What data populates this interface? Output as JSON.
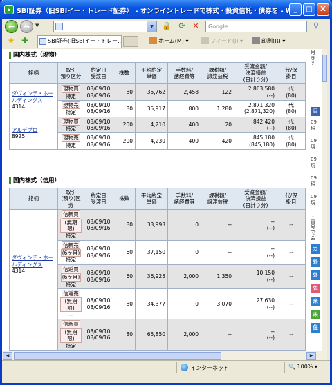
{
  "window": {
    "title": "SBI証券（旧SBIイー・トレード証券） - オンライントレードで株式・投資信託・債券を - Win...",
    "minimize": "_",
    "maximize": "□",
    "close": "X"
  },
  "addressbar": {
    "back": "←",
    "forward": "→",
    "url": "",
    "search_placeholder": "Google"
  },
  "tabs": {
    "active_tab": "SBI証券(旧SBIイー・トレー...",
    "home": "ホーム(M)",
    "feeds": "フィード(J)",
    "print": "印刷(R)"
  },
  "sections": [
    {
      "title": "国内株式（現物）",
      "headers": [
        "銘柄",
        "取引\n預り区分",
        "約定日\n受渡日",
        "株数",
        "平均約定\n単価",
        "手数料/\n諸経費等",
        "課税額/\n譲渡益税",
        "受渡金額/\n決済損益\n(日計り分)",
        "代/保\n掛目"
      ],
      "rows": [
        {
          "name": "ダヴィンチ・ホールディングス",
          "code": "4314",
          "type": "現物買",
          "sub": "特定",
          "date1": "08/09/10",
          "date2": "08/09/16",
          "qty": "80",
          "price": "35,762",
          "fee": "2,458",
          "tax": "122",
          "amt1": "2,863,580",
          "amt2": "(--)",
          "m1": "代",
          "m2": "(80)"
        },
        {
          "name": "",
          "code": "",
          "type": "現物売",
          "sub": "特定",
          "date1": "08/09/10",
          "date2": "08/09/16",
          "qty": "80",
          "price": "35,917",
          "fee": "800",
          "tax": "1,280",
          "amt1": "2,871,320",
          "amt2": "(2,871,320)",
          "m1": "代",
          "m2": "(80)"
        },
        {
          "name": "アルデプロ",
          "code": "8925",
          "type": "現物買",
          "sub": "特定",
          "date1": "08/09/10",
          "date2": "08/09/16",
          "qty": "200",
          "price": "4,210",
          "fee": "400",
          "tax": "20",
          "amt1": "842,420",
          "amt2": "(--)",
          "m1": "代",
          "m2": "(80)"
        },
        {
          "name": "",
          "code": "",
          "type": "現物売",
          "sub": "特定",
          "date1": "08/09/10",
          "date2": "08/09/16",
          "qty": "200",
          "price": "4,230",
          "fee": "400",
          "tax": "420",
          "amt1": "845,180",
          "amt2": "(845,180)",
          "m1": "代",
          "m2": "(80)"
        }
      ]
    },
    {
      "title": "国内株式（信用）",
      "headers": [
        "銘柄",
        "取引\n(預り)区\n分",
        "約定日\n受渡日",
        "株数",
        "平均約定\n単価",
        "手数料/\n諸経費等",
        "課税額/\n譲渡益税",
        "受渡金額/\n決済損益\n(日計り分)",
        "代/保\n掛目"
      ],
      "rows": [
        {
          "name": "ダヴィンチ・ホールディングス",
          "code": "4314",
          "type": "信新買",
          "type2": "(無期限)",
          "sub": "特定",
          "date1": "08/09/10",
          "date2": "08/09/16",
          "qty": "80",
          "price": "33,993",
          "fee": "0",
          "tax": "--",
          "amt1": "--",
          "amt2": "(--)",
          "m1": "--",
          "m2": ""
        },
        {
          "name": "",
          "code": "",
          "type": "信新売",
          "type2": "(6ヶ月)",
          "sub": "特定",
          "date1": "08/09/10",
          "date2": "08/09/16",
          "qty": "60",
          "price": "37,150",
          "fee": "0",
          "tax": "--",
          "amt1": "--",
          "amt2": "(--)",
          "m1": "--",
          "m2": ""
        },
        {
          "name": "",
          "code": "",
          "type": "信返買",
          "type2": "(6ヶ月)",
          "sub": "特定",
          "date1": "08/09/10",
          "date2": "08/09/16",
          "qty": "60",
          "price": "36,925",
          "fee": "2,000",
          "tax": "1,350",
          "amt1": "10,150",
          "amt2": "(--)",
          "m1": "--",
          "m2": ""
        },
        {
          "name": "",
          "code": "",
          "type": "信返売",
          "type2": "(無期限)",
          "sub": "--",
          "date1": "08/09/10",
          "date2": "08/09/16",
          "qty": "80",
          "price": "34,377",
          "fee": "0",
          "tax": "3,070",
          "amt1": "27,630",
          "amt2": "(--)",
          "m1": "--",
          "m2": ""
        },
        {
          "name": "",
          "code": "",
          "type": "信新買",
          "type2": "(無期限)",
          "sub": "特定",
          "date1": "08/09/10",
          "date2": "08/09/16",
          "qty": "80",
          "price": "65,850",
          "fee": "2,000",
          "tax": "--",
          "amt1": "--",
          "amt2": "(--)",
          "m1": "--",
          "m2": ""
        }
      ]
    }
  ],
  "sidebar": {
    "top_text": "月\nき\nす",
    "dates": [
      "09",
      "09",
      "09",
      "09",
      "09"
    ],
    "mid_chars": [
      "現",
      "現",
      "現",
      "現",
      "現"
    ],
    "bottom_text": "・\n番\n号\nで\n会",
    "buttons": [
      {
        "label": "カ",
        "color": "#2f7fd0"
      },
      {
        "label": "外",
        "color": "#2f7fd0"
      },
      {
        "label": "外",
        "color": "#2f7fd0"
      },
      {
        "label": "先",
        "color": "#e05a78"
      },
      {
        "label": "米",
        "color": "#2f7fd0"
      },
      {
        "label": "未",
        "color": "#49a538"
      },
      {
        "label": "住",
        "color": "#2f7fd0"
      }
    ]
  },
  "status": {
    "zone": "インターネット",
    "zoom": "100%"
  }
}
